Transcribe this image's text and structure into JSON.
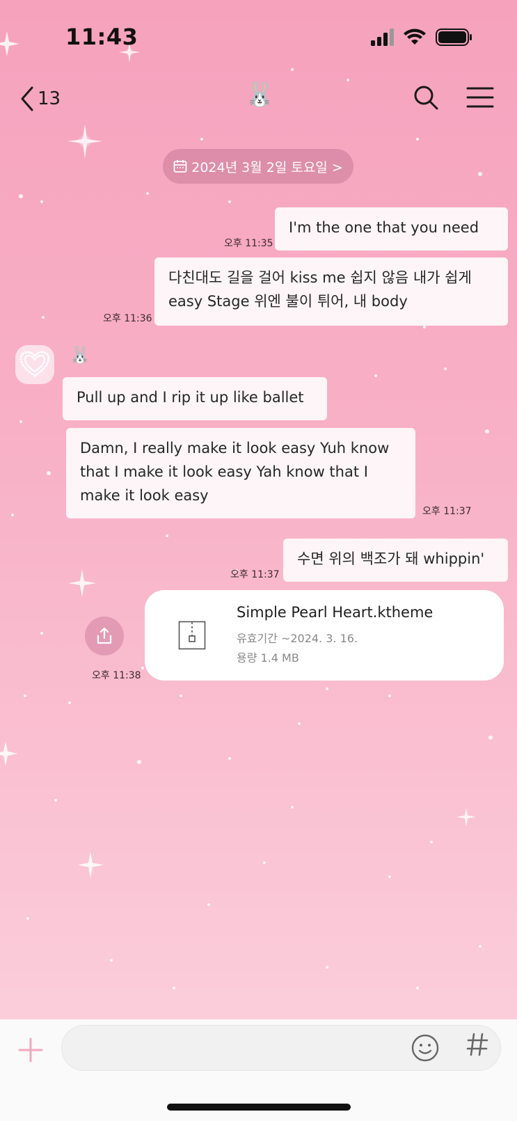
{
  "status_bar": {
    "time": "11:43"
  },
  "header": {
    "back_count": "13",
    "title_emoji": "🐰"
  },
  "date_pill": {
    "label": "2024년 3월 2일 토요일 >"
  },
  "messages": [
    {
      "side": "right",
      "text": "I'm the one that you need",
      "time": "오후 11:35"
    },
    {
      "side": "right",
      "text": "다친대도 길을 걸어 kiss me 쉽지 않음 내가 쉽게 easy Stage 위엔 불이 튀어, 내 body",
      "time": "오후 11:36"
    },
    {
      "side": "left",
      "sender": "🐰",
      "text": "Pull up and I rip it up like ballet"
    },
    {
      "side": "left",
      "text": "Damn, I really make it look easy Yuh know that I make it look easy Yah know that I make it look easy",
      "time": "오후 11:37"
    },
    {
      "side": "right",
      "text": "수면 위의 백조가 돼 whippin'",
      "time": "오후 11:37"
    }
  ],
  "file_message": {
    "name": "Simple Pearl Heart.ktheme",
    "expiry": "유효기간  ~2024. 3. 16.",
    "size": "용량  1.4 MB",
    "time": "오후 11:38"
  },
  "input": {
    "placeholder": ""
  },
  "colors": {
    "background_top": "#f6a2bd",
    "background_bottom": "#fcd2de",
    "bubble": "#fdf5f7",
    "pill": "#c87896"
  }
}
